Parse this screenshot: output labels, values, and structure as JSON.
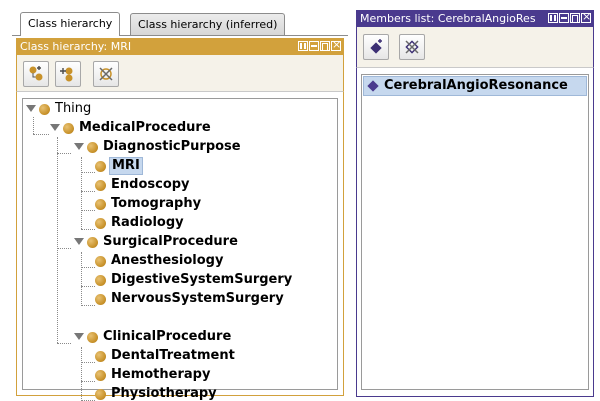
{
  "tabs": [
    {
      "label": "Class hierarchy",
      "active": true
    },
    {
      "label": "Class hierarchy (inferred)",
      "active": false
    }
  ],
  "class_view": {
    "header": "Class hierarchy: MRI",
    "accent_color": "#d2a13c",
    "toolbar": [
      {
        "icon": "add-subclass-icon"
      },
      {
        "icon": "add-sibling-class-icon"
      },
      {
        "icon": "delete-class-icon"
      }
    ]
  },
  "tree": {
    "root": "Thing",
    "nodes": [
      {
        "label": "MedicalProcedure"
      },
      {
        "label": "DiagnosticPurpose"
      },
      {
        "label": "MRI",
        "selected": true
      },
      {
        "label": "Endoscopy"
      },
      {
        "label": "Tomography"
      },
      {
        "label": "Radiology"
      },
      {
        "label": "SurgicalProcedure"
      },
      {
        "label": "Anesthesiology"
      },
      {
        "label": "DigestiveSystemSurgery"
      },
      {
        "label": "NervousSystemSurgery"
      },
      {
        "label": "ClinicalProcedure"
      },
      {
        "label": "DentalTreatment"
      },
      {
        "label": "Hemotherapy"
      },
      {
        "label": "Physiotherapy"
      }
    ]
  },
  "members_view": {
    "header": "Members list: CerebralAngioRes",
    "accent_color": "#4a3a8e",
    "toolbar": [
      {
        "icon": "add-individual-icon"
      },
      {
        "icon": "delete-individual-icon"
      }
    ],
    "items": [
      {
        "label": "CerebralAngioResonance",
        "selected": true
      }
    ]
  }
}
